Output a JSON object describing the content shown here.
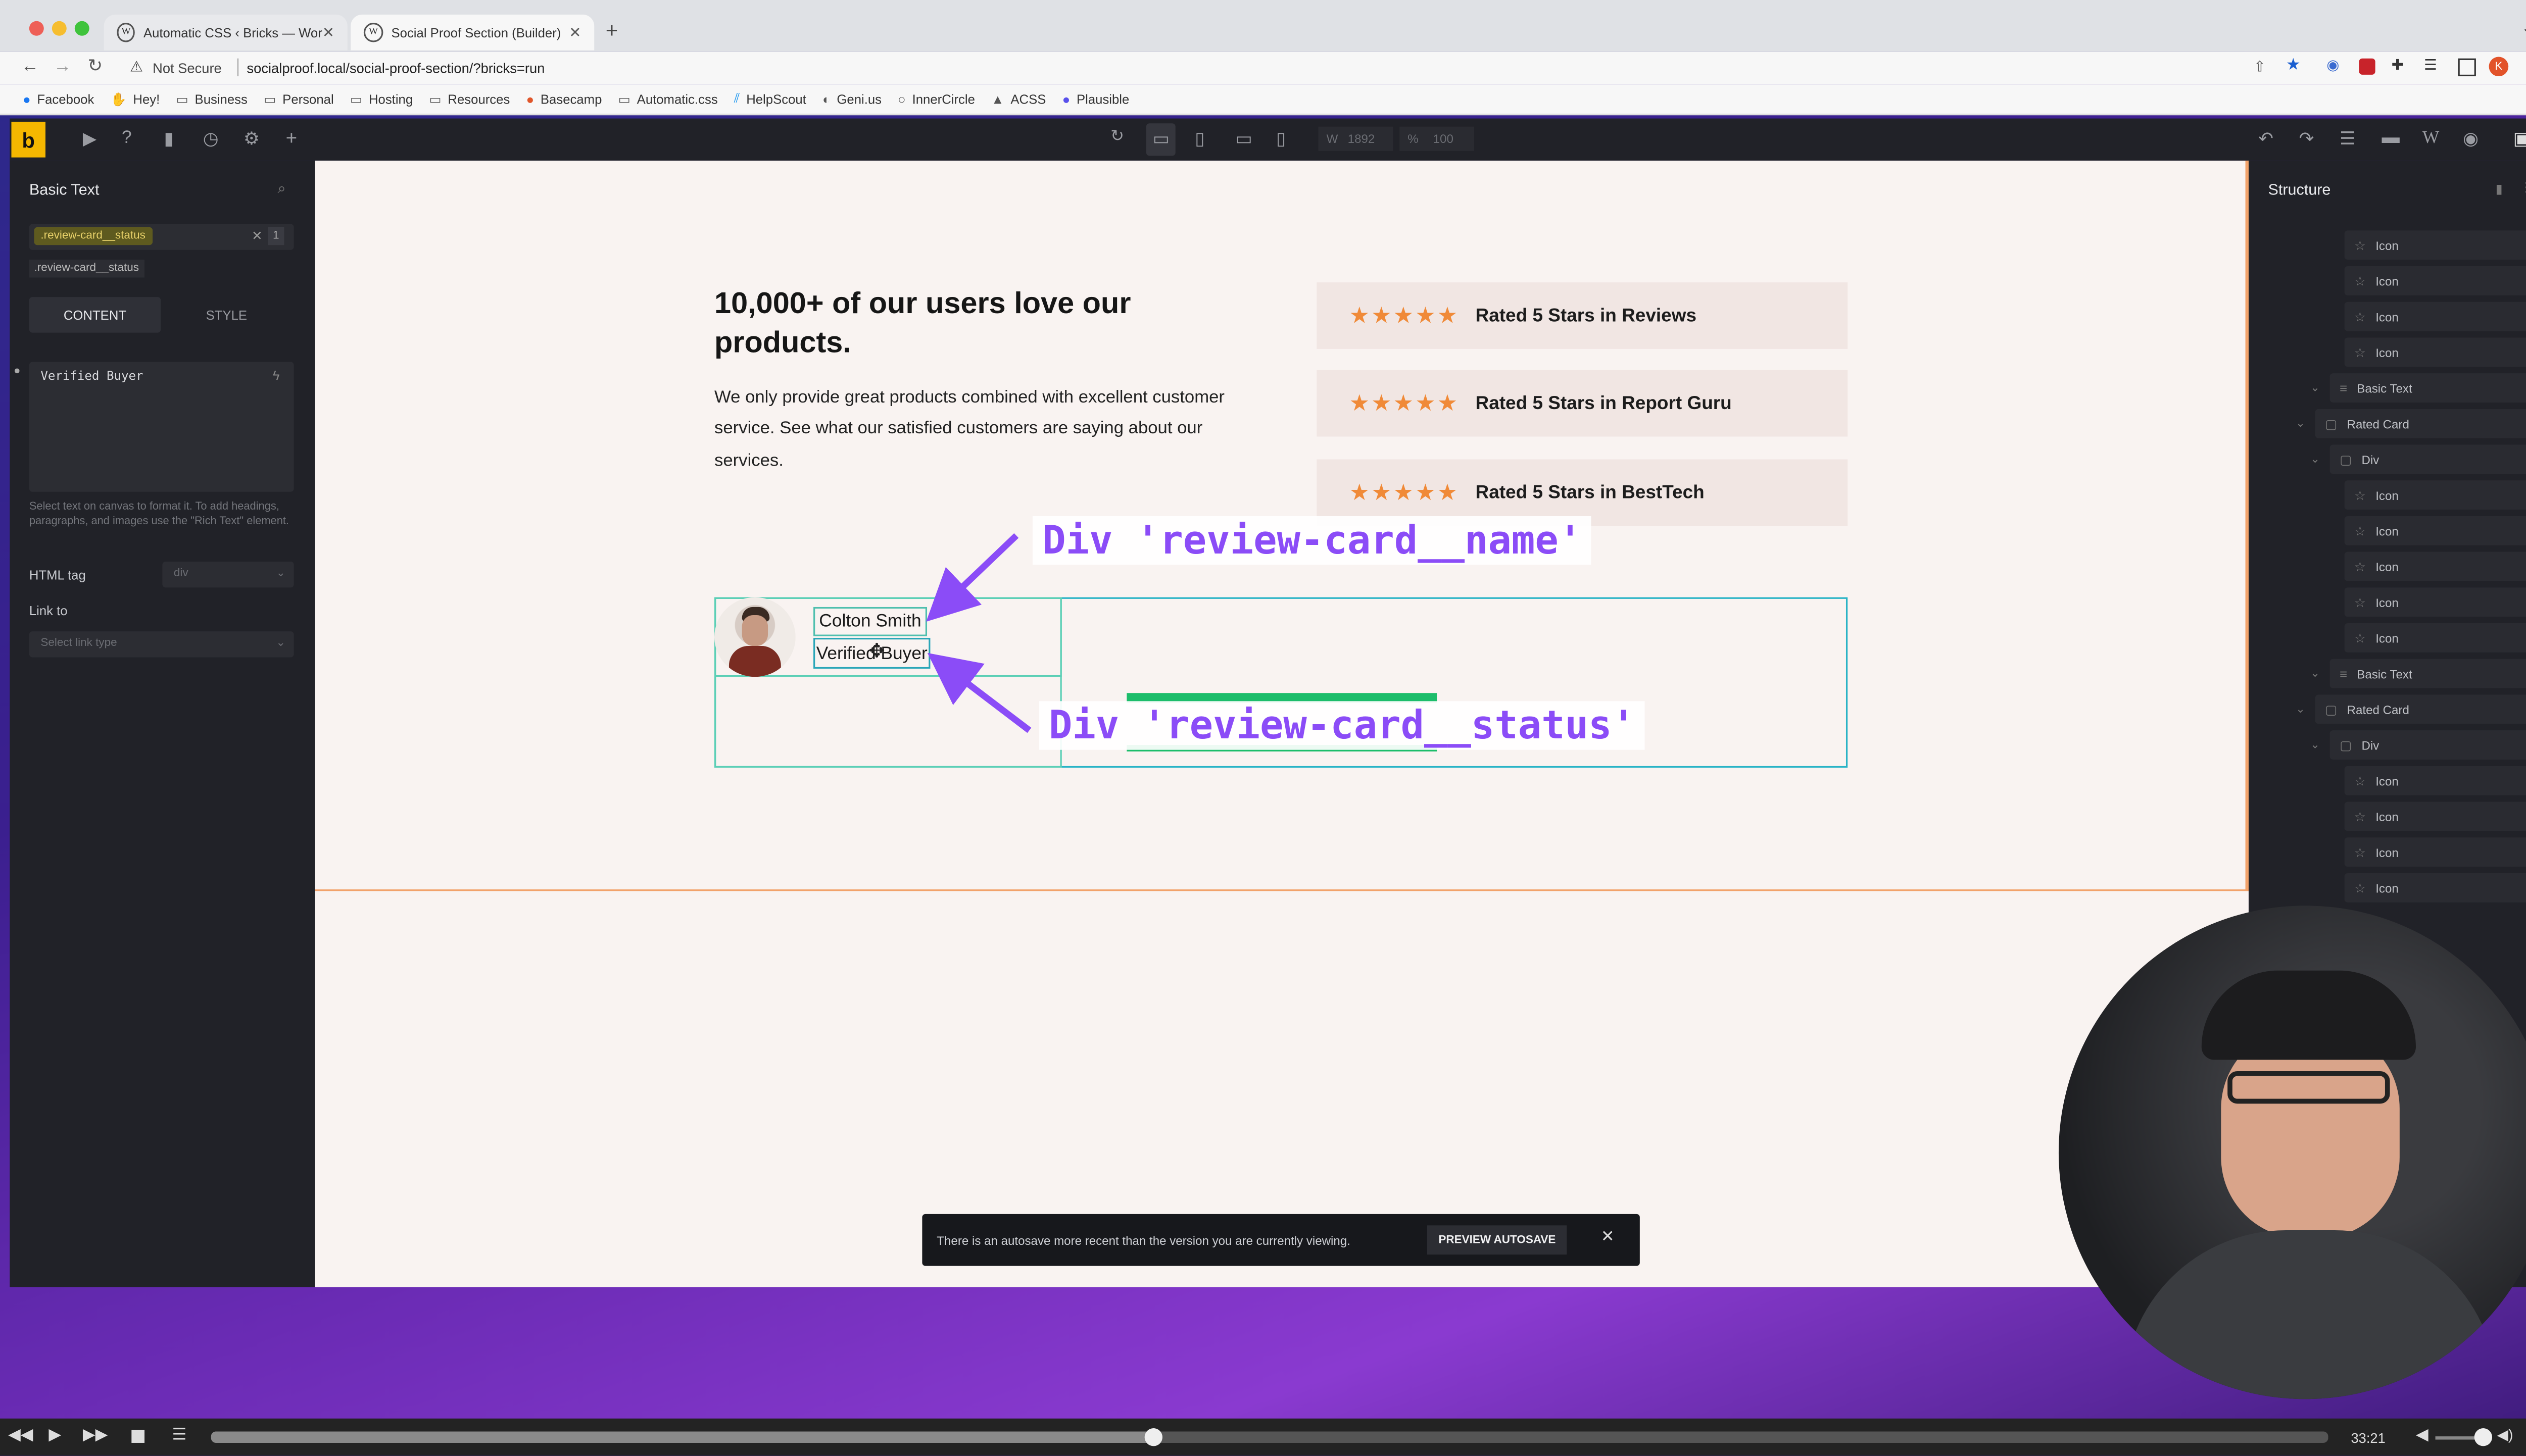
{
  "browser": {
    "tabs": [
      {
        "label": "Automatic CSS ‹ Bricks — Wor"
      },
      {
        "label": "Social Proof Section (Builder)"
      }
    ],
    "address": {
      "security": "Not Secure",
      "url": "socialproof.local/social-proof-section/?bricks=run"
    },
    "bookmarks": [
      "Facebook",
      "Hey!",
      "Business",
      "Personal",
      "Hosting",
      "Resources",
      "Basecamp",
      "Automatic.css",
      "HelpScout",
      "Geni.us",
      "InnerCircle",
      "ACSS",
      "Plausible"
    ]
  },
  "toolbar": {
    "logo": "b",
    "width_label": "W",
    "width_value": "1892",
    "zoom_label": "%",
    "zoom_value": "100"
  },
  "left_panel": {
    "title": "Basic Text",
    "class_chip": ".review-card__status",
    "class_count": "1",
    "class_suggestion": ".review-card__status",
    "tabs": [
      "CONTENT",
      "STYLE"
    ],
    "text_value": "Verified Buyer",
    "help_text": "Select text on canvas to format it. To add headings, paragraphs, and images use the \"Rich Text\" element.",
    "html_tag_label": "HTML tag",
    "html_tag_value": "div",
    "link_label": "Link to",
    "link_placeholder": "Select link type"
  },
  "canvas": {
    "heading": "10,000+ of our users love our products.",
    "paragraph": "We only provide great products combined with excellent customer service. See what our satisfied customers are saying about our services.",
    "rated_cards": [
      "Rated 5 Stars in Reviews",
      "Rated 5 Stars in Report Guru",
      "Rated 5 Stars in BestTech"
    ],
    "review": {
      "name": "Colton Smith",
      "status": "Verified Buyer"
    },
    "annotations": {
      "name": "Div 'review-card__name'",
      "status": "Div 'review-card__status'"
    },
    "toast": {
      "message": "There is an autosave more recent than the version you are currently viewing.",
      "button": "PREVIEW AUTOSAVE"
    }
  },
  "structure": {
    "title": "Structure",
    "rows": [
      {
        "label": "Icon",
        "indent": "deep"
      },
      {
        "label": "Icon",
        "indent": "deep"
      },
      {
        "label": "Icon",
        "indent": "deep"
      },
      {
        "label": "Icon",
        "indent": "deep"
      },
      {
        "label": "Basic Text",
        "indent": "mid"
      },
      {
        "label": "Rated Card",
        "indent": "top"
      },
      {
        "label": "Div",
        "indent": "mid"
      },
      {
        "label": "Icon",
        "indent": "deep"
      },
      {
        "label": "Icon",
        "indent": "deep"
      },
      {
        "label": "Icon",
        "indent": "deep"
      },
      {
        "label": "Icon",
        "indent": "deep"
      },
      {
        "label": "Icon",
        "indent": "deep"
      },
      {
        "label": "Basic Text",
        "indent": "mid"
      },
      {
        "label": "Rated Card",
        "indent": "top"
      },
      {
        "label": "Div",
        "indent": "mid"
      },
      {
        "label": "Icon",
        "indent": "deep"
      },
      {
        "label": "Icon",
        "indent": "deep"
      },
      {
        "label": "Icon",
        "indent": "deep"
      },
      {
        "label": "Icon",
        "indent": "deep"
      }
    ]
  },
  "player": {
    "time": "33:21",
    "progress": 0.445
  }
}
